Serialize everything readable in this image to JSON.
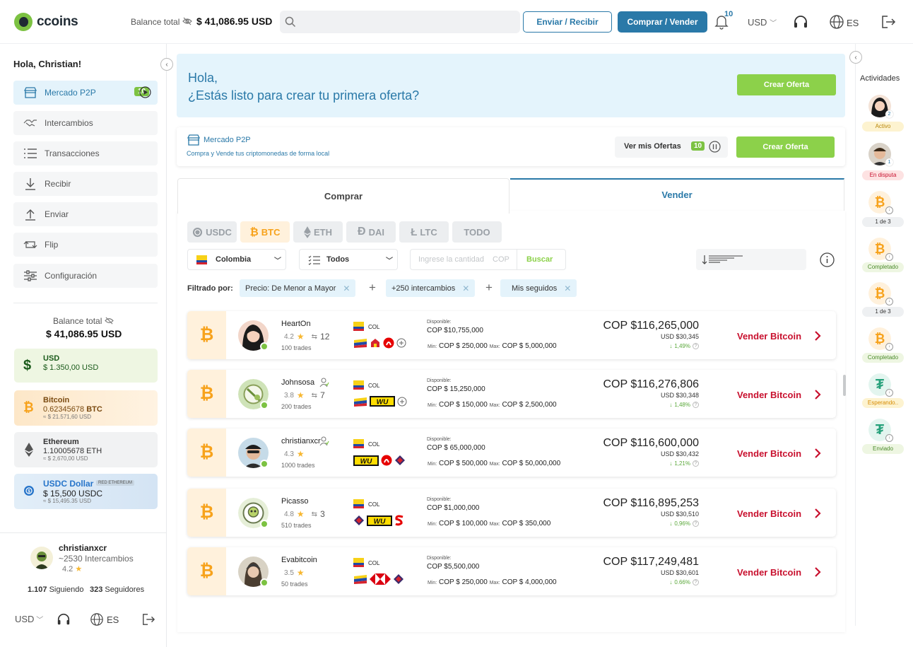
{
  "header": {
    "logo": "ccoins",
    "balance_label": "Balance total",
    "balance_value": "$ 41,086.95 USD",
    "send_receive": "Enviar / Recibir",
    "buy_sell": "Comprar / Vender",
    "notifications": "10",
    "currency": "USD",
    "language": "ES"
  },
  "sidebar": {
    "greeting": "Hola, Christian!",
    "items": [
      {
        "label": "Mercado P2P",
        "badge": "10"
      },
      {
        "label": "Intercambios"
      },
      {
        "label": "Transacciones"
      },
      {
        "label": "Recibir"
      },
      {
        "label": "Enviar"
      },
      {
        "label": "Flip"
      },
      {
        "label": "Configuración"
      }
    ],
    "balance_label": "Balance total",
    "balance_value": "$ 41,086.95 USD",
    "wallets": [
      {
        "name": "USD",
        "value": "$ 1.350,00 USD",
        "sub": ""
      },
      {
        "name": "Bitcoin",
        "value": "0.62345678",
        "unit": "BTC",
        "sub": "≈ $ 21.571,60 USD"
      },
      {
        "name": "Ethereum",
        "value": "1.10005678 ETH",
        "sub": "≈ $ 2,670,00 USD"
      },
      {
        "name": "USDC Dollar",
        "tag": "RED ETHEREUM",
        "value": "$ 15,500 USDC",
        "sub": "≈ $ 15,495.35 USD"
      }
    ],
    "user": {
      "name": "christianxcr",
      "exchanges": "~2530 Intercambios",
      "rating": "4.2"
    },
    "following_count": "1.107",
    "following_label": "Siguiendo",
    "followers_count": "323",
    "followers_label": "Seguidores",
    "currency": "USD",
    "language": "ES"
  },
  "hero": {
    "line1": "Hola,",
    "line2": "¿Estás listo para crear tu primera oferta?",
    "cta": "Crear Oferta"
  },
  "market": {
    "title": "Mercado P2P",
    "subtitle": "Compra y Vende tus criptomonedas de forma local",
    "my_offers": "Ver mis Ofertas",
    "my_offers_badge": "10",
    "cta": "Crear Oferta"
  },
  "tabs": {
    "buy": "Comprar",
    "sell": "Vender"
  },
  "coins": [
    "USDC",
    "BTC",
    "ETH",
    "DAI",
    "LTC",
    "TODO"
  ],
  "filters": {
    "country": "Colombia",
    "payment": "Todos",
    "amount_placeholder": "Ingrese la cantidad",
    "amount_currency": "COP",
    "search": "Buscar",
    "filtered_by": "Filtrado por:",
    "chips": [
      "Precio: De Menor a Mayor",
      "+250 intercambios",
      "Mis seguidos"
    ]
  },
  "offers": [
    {
      "name": "HeartOn",
      "rating": "4.2",
      "exchanges": "12",
      "trades": "100 trades",
      "country": "COL",
      "available": "COP $10,755,000",
      "min": "COP $ 250,000",
      "max": "COP $ 5,000,000",
      "price": "COP $116,265,000",
      "usd": "USD $30,345",
      "change": "1,49%"
    },
    {
      "name": "Johnsosa",
      "rating": "3.8",
      "exchanges": "7",
      "trades": "200 trades",
      "country": "COL",
      "available": "COP $ 15,250,000",
      "min": "COP $ 150,000",
      "max": "COP $ 2,500,000",
      "price": "COP $116,276,806",
      "usd": "USD $30,348",
      "change": "1,48%"
    },
    {
      "name": "christianxcr",
      "rating": "4.3",
      "exchanges": "",
      "trades": "1000 trades",
      "country": "COL",
      "available": "COP $ 65,000,000",
      "min": "COP $ 500,000",
      "max": "COP $ 50,000,000",
      "price": "COP $116,600,000",
      "usd": "USD $30,432",
      "change": "1,21%"
    },
    {
      "name": "Picasso",
      "rating": "4.8",
      "exchanges": "3",
      "trades": "510 trades",
      "country": "COL",
      "available": "COP $1,000,000",
      "min": "COP $ 100,000",
      "max": "COP $ 350,000",
      "price": "COP $116,895,253",
      "usd": "USD $30,510",
      "change": "0,96%"
    },
    {
      "name": "Evabitcoin",
      "rating": "3.5",
      "exchanges": "",
      "trades": "50 trades",
      "country": "COL",
      "available": "COP $5,500,000",
      "min": "COP $ 250,000",
      "max": "COP $ 4,000,000",
      "price": "COP $117,249,481",
      "usd": "USD $30,601",
      "change": "0.66%"
    }
  ],
  "offer_labels": {
    "available": "Disponible:",
    "min": "Min:",
    "max": "Max:",
    "sell": "Vender Bitcoin"
  },
  "activities": {
    "title": "Actividades",
    "items": [
      {
        "label": "Activo",
        "count": "2"
      },
      {
        "label": "En disputa",
        "count": "1"
      },
      {
        "label": "1 de 3"
      },
      {
        "label": "Completado"
      },
      {
        "label": "1 de 3"
      },
      {
        "label": "Completado"
      },
      {
        "label": "Esperando.."
      },
      {
        "label": "Enviado"
      }
    ]
  }
}
